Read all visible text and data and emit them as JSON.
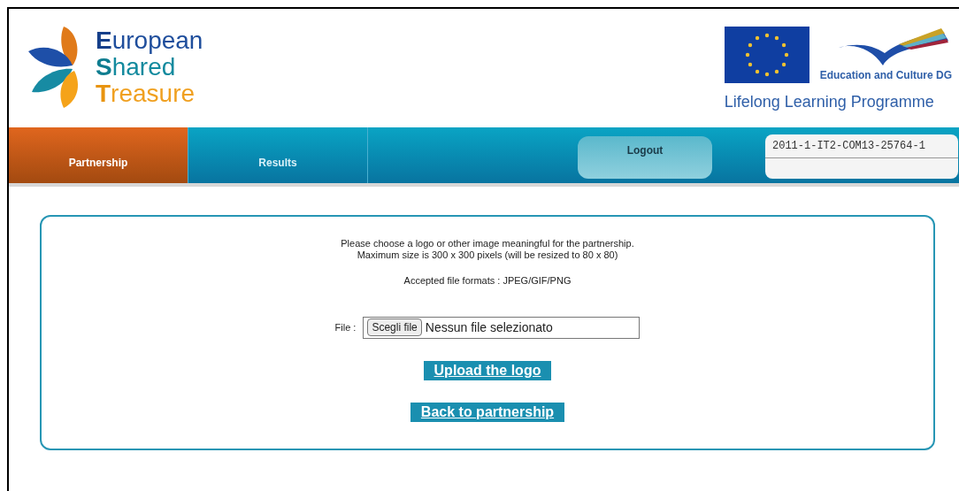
{
  "logo": {
    "lines": [
      "European",
      "Shared",
      "Treasure"
    ]
  },
  "programme": {
    "dg": "Education and Culture DG",
    "name": "Lifelong Learning Programme"
  },
  "tabs": [
    {
      "label": "Partnership",
      "selected": true
    },
    {
      "label": "Results",
      "selected": false
    }
  ],
  "logout": "Logout",
  "project_code": "2011-1-IT2-COM13-25764-1",
  "form": {
    "intro": [
      "Please choose a logo or other image meaningful for the partnership.",
      "Maximum size is 300 x 300 pixels (will be resized to 80 x 80)"
    ],
    "formats": "Accepted file formats : JPEG/GIF/PNG",
    "file_label": "File :",
    "file_button": "Scegli file",
    "file_status": "Nessun file selezionato",
    "buttons": [
      "Upload the logo",
      "Back to partnership"
    ]
  }
}
